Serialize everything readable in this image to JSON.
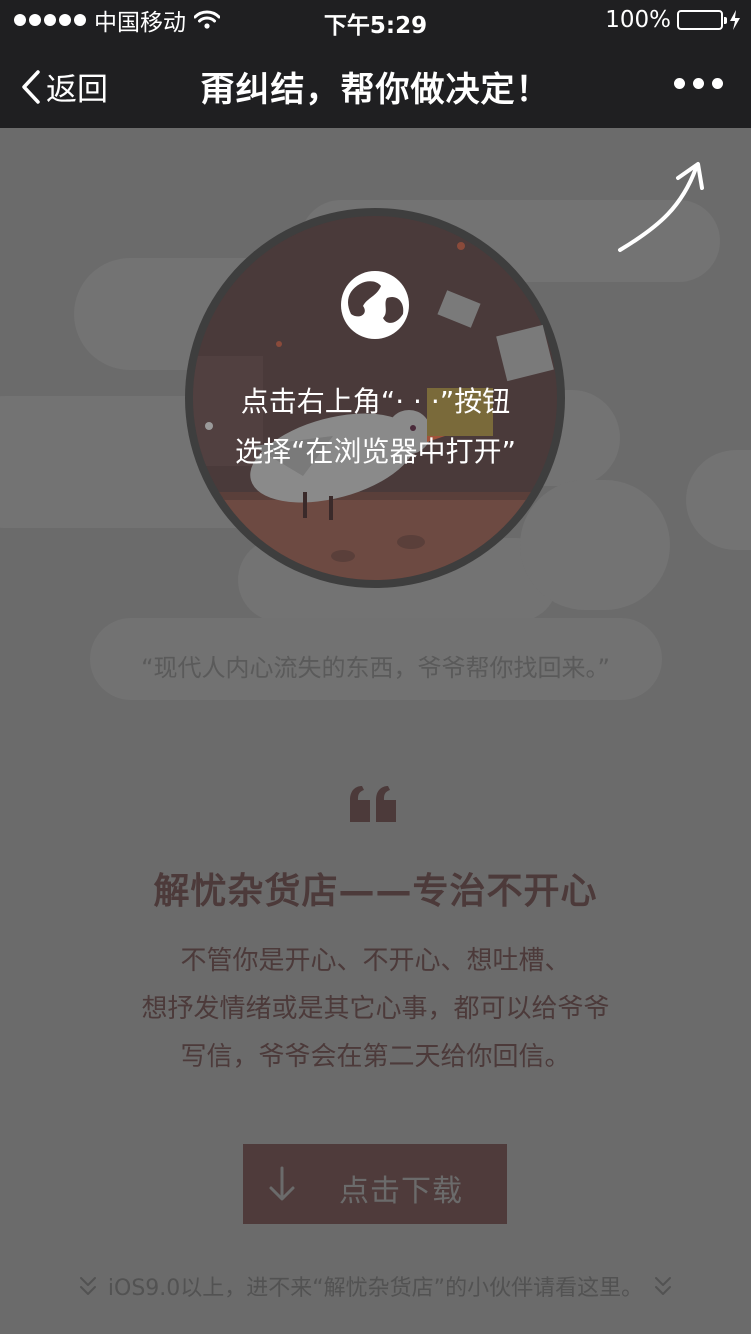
{
  "status_bar": {
    "carrier": "中国移动",
    "time": "下午5:29",
    "battery": "100%"
  },
  "nav": {
    "back_label": "返回",
    "title": "甭纠结，帮你做决定！"
  },
  "overlay": {
    "line1": "点击右上角“· · ·”按钮",
    "line2": "选择“在浏览器中打开”"
  },
  "quote": "“现代人内心流失的东西，爷爷帮你找回来。”",
  "headline": "解忧杂货店——专治不开心",
  "description": {
    "line1": "不管你是开心、不开心、想吐槽、",
    "line2": "想抒发情绪或是其它心事，都可以给爷爷",
    "line3": "写信，爷爷会在第二天给你回信。"
  },
  "download_button": {
    "label": "点击下载"
  },
  "footer": {
    "text": "iOS9.0以上，进不来“解忧杂货店”的小伙伴请看这里。"
  },
  "colors": {
    "nav_background": "#1f1f21",
    "page_overlay": "#6b6b6b",
    "accent_brown": "#4f3b3b",
    "battery_green": "#4cd964"
  }
}
